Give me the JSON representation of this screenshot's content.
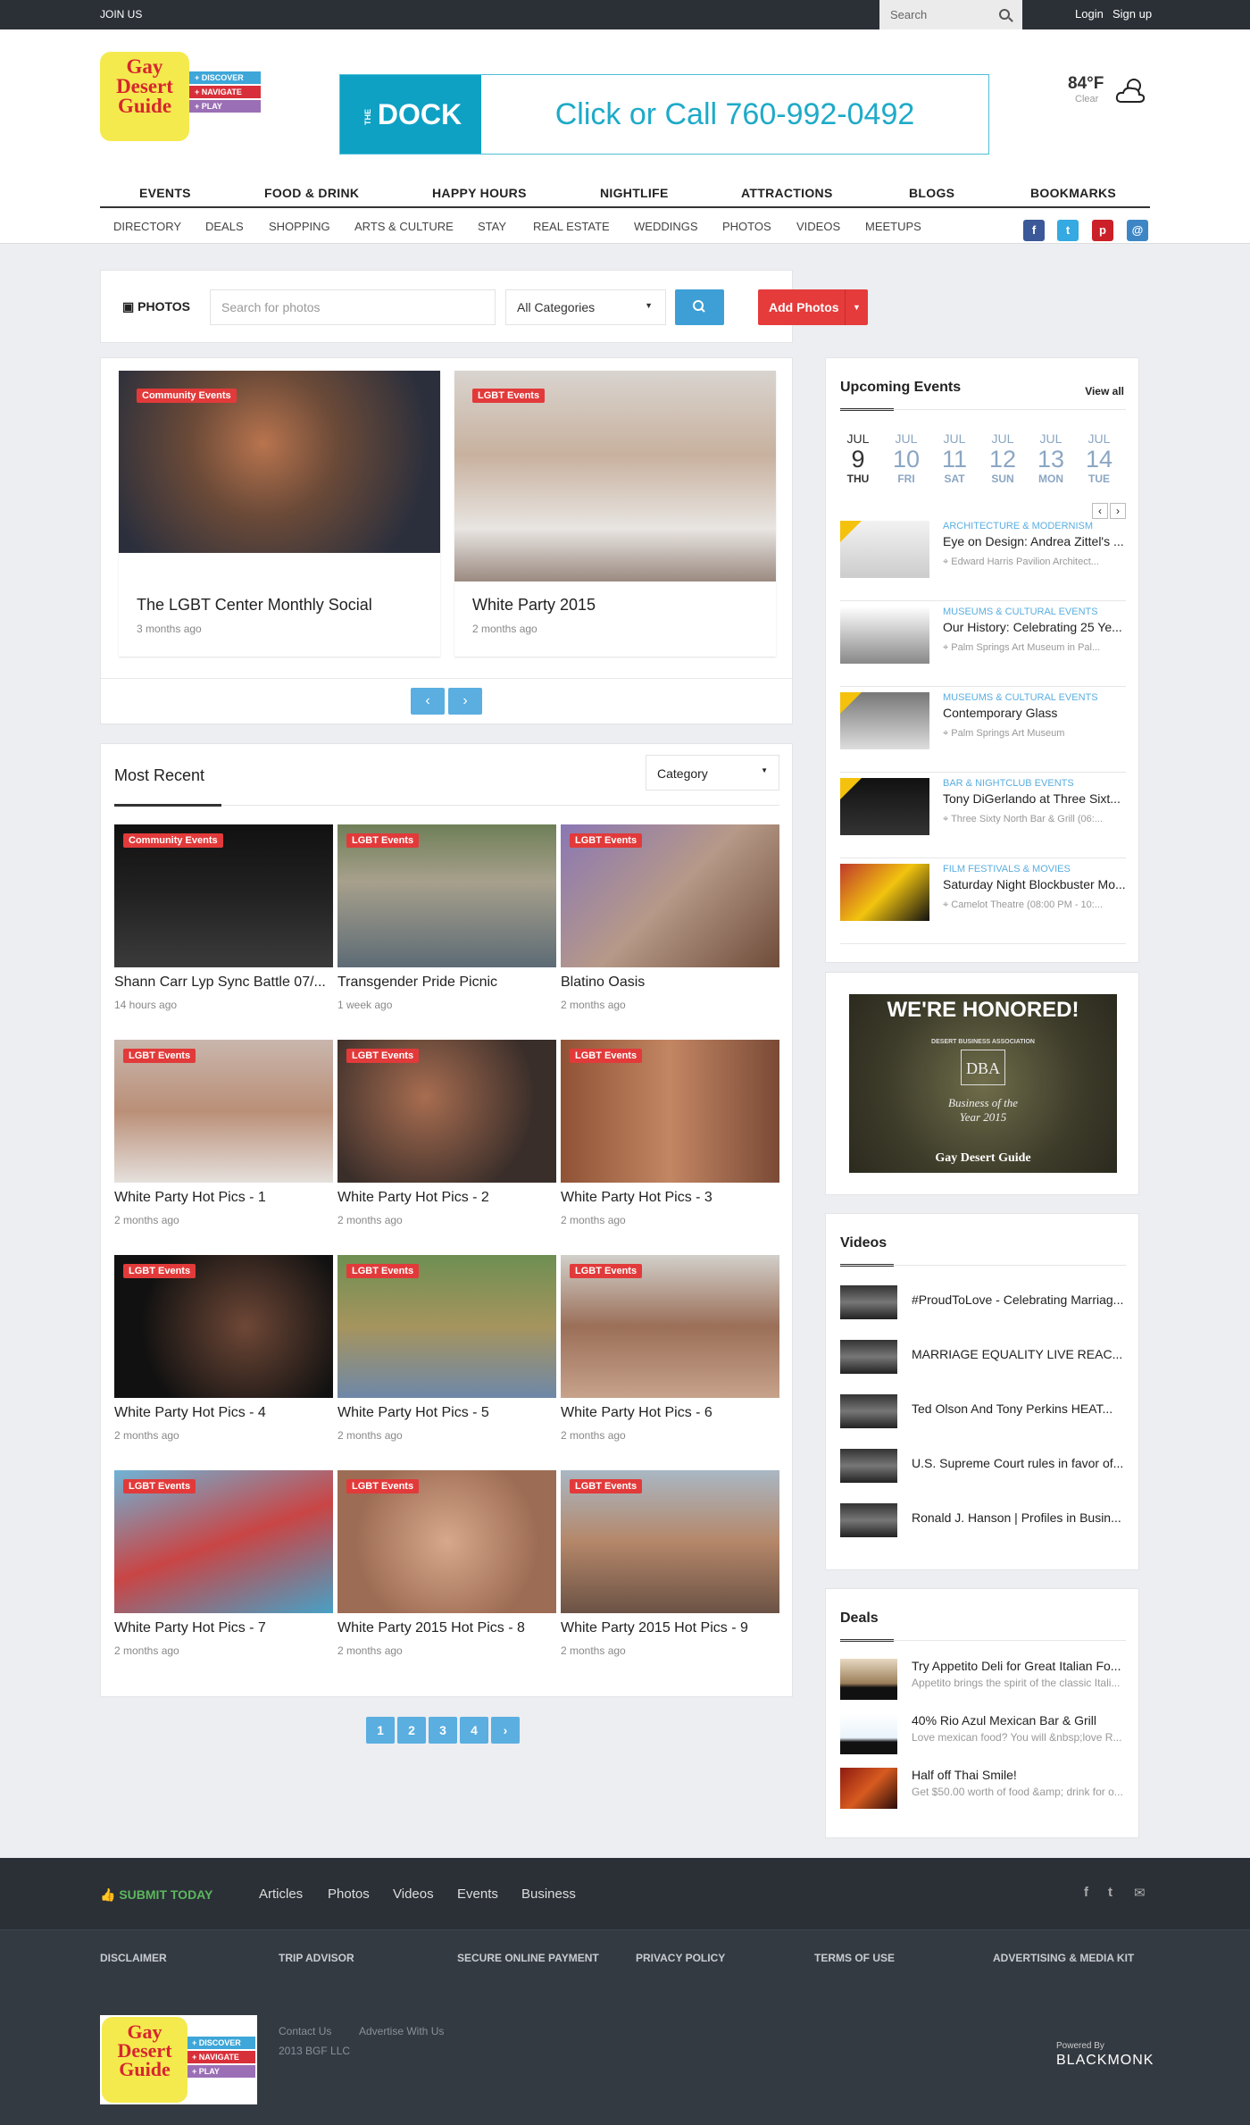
{
  "topbar": {
    "join": "JOIN US",
    "search_placeholder": "Search",
    "login": "Login",
    "signup": "Sign up"
  },
  "logo": {
    "line1": "Gay",
    "line2": "Desert",
    "line3": "Guide",
    "tag1": "+ DISCOVER",
    "tag2": "+ NAVIGATE",
    "tag3": "+ PLAY"
  },
  "ad": {
    "brand": "DOCK",
    "brand_prefix": "THE",
    "cta": "Click or Call 760-992-0492"
  },
  "weather": {
    "temp": "84°F",
    "cond": "Clear"
  },
  "nav": [
    "EVENTS",
    "FOOD & DRINK",
    "HAPPY HOURS",
    "NIGHTLIFE",
    "ATTRACTIONS",
    "BLOGS",
    "BOOKMARKS"
  ],
  "subnav": [
    "DIRECTORY",
    "DEALS",
    "SHOPPING",
    "ARTS & CULTURE",
    "STAY",
    "REAL ESTATE",
    "WEDDINGS",
    "PHOTOS",
    "VIDEOS",
    "MEETUPS"
  ],
  "photosbar": {
    "label": "PHOTOS",
    "search_placeholder": "Search for photos",
    "category": "All Categories",
    "add": "Add Photos"
  },
  "featured": [
    {
      "badge": "Community Events",
      "title": "The LGBT Center Monthly Social",
      "ago": "3 months ago"
    },
    {
      "badge": "LGBT Events",
      "title": "White Party 2015",
      "ago": "2 months ago"
    }
  ],
  "recent": {
    "title": "Most Recent",
    "category": "Category",
    "items": [
      {
        "badge": "Community Events",
        "title": "Shann Carr Lyp Sync Battle 07/...",
        "ago": "14 hours ago"
      },
      {
        "badge": "LGBT Events",
        "title": "Transgender Pride Picnic",
        "ago": "1 week ago"
      },
      {
        "badge": "LGBT Events",
        "title": "Blatino Oasis",
        "ago": "2 months ago"
      },
      {
        "badge": "LGBT Events",
        "title": "White Party Hot Pics - 1",
        "ago": "2 months ago"
      },
      {
        "badge": "LGBT Events",
        "title": "White Party Hot Pics - 2",
        "ago": "2 months ago"
      },
      {
        "badge": "LGBT Events",
        "title": "White Party Hot Pics - 3",
        "ago": "2 months ago"
      },
      {
        "badge": "LGBT Events",
        "title": "White Party Hot Pics - 4",
        "ago": "2 months ago"
      },
      {
        "badge": "LGBT Events",
        "title": "White Party Hot Pics - 5",
        "ago": "2 months ago"
      },
      {
        "badge": "LGBT Events",
        "title": "White Party Hot Pics - 6",
        "ago": "2 months ago"
      },
      {
        "badge": "LGBT Events",
        "title": "White Party Hot Pics - 7",
        "ago": "2 months ago"
      },
      {
        "badge": "LGBT Events",
        "title": "White Party 2015 Hot Pics - 8",
        "ago": "2 months ago"
      },
      {
        "badge": "LGBT Events",
        "title": "White Party 2015 Hot Pics - 9",
        "ago": "2 months ago"
      }
    ]
  },
  "pagination": [
    "1",
    "2",
    "3",
    "4",
    "›"
  ],
  "upcoming": {
    "title": "Upcoming Events",
    "viewall": "View all",
    "days": [
      {
        "m": "JUL",
        "d": "9",
        "w": "THU"
      },
      {
        "m": "JUL",
        "d": "10",
        "w": "FRI"
      },
      {
        "m": "JUL",
        "d": "11",
        "w": "SAT"
      },
      {
        "m": "JUL",
        "d": "12",
        "w": "SUN"
      },
      {
        "m": "JUL",
        "d": "13",
        "w": "MON"
      },
      {
        "m": "JUL",
        "d": "14",
        "w": "TUE"
      }
    ],
    "events": [
      {
        "cat": "ARCHITECTURE & MODERNISM",
        "name": "Eye on Design: Andrea Zittel's ...",
        "loc": "Edward Harris Pavilion Architect..."
      },
      {
        "cat": "MUSEUMS & CULTURAL EVENTS",
        "name": "Our History: Celebrating 25 Ye...",
        "loc": "Palm Springs Art Museum in Pal..."
      },
      {
        "cat": "MUSEUMS & CULTURAL EVENTS",
        "name": "Contemporary Glass",
        "loc": "Palm Springs Art Museum"
      },
      {
        "cat": "BAR & NIGHTCLUB EVENTS",
        "name": "Tony DiGerlando at Three Sixt...",
        "loc": "Three Sixty North Bar & Grill (06:..."
      },
      {
        "cat": "FILM FESTIVALS & MOVIES",
        "name": "Saturday Night Blockbuster Mo...",
        "loc": "Camelot Theatre (08:00 PM - 10:..."
      }
    ]
  },
  "honored": {
    "headline": "WE'RE HONORED!",
    "org": "DESERT BUSINESS ASSOCIATION",
    "abbr": "DBA",
    "award": "Business of the Year 2015",
    "name": "Gay Desert Guide"
  },
  "videos": {
    "title": "Videos",
    "items": [
      "#ProudToLove - Celebrating Marriag...",
      "MARRIAGE EQUALITY LIVE REAC...",
      "Ted Olson And Tony Perkins HEAT...",
      "U.S. Supreme Court rules in favor of...",
      "Ronald J. Hanson | Profiles in Busin..."
    ]
  },
  "deals": {
    "title": "Deals",
    "items": [
      {
        "name": "Try Appetito Deli for Great Italian Fo...",
        "desc": "Appetito brings the spirit of the classic Itali..."
      },
      {
        "name": "40% Rio Azul Mexican Bar & Grill",
        "desc": "Love mexican food? You will &nbsp;love R..."
      },
      {
        "name": "Half off Thai Smile!",
        "desc": "Get $50.00 worth of food &amp; drink for o..."
      }
    ]
  },
  "footer": {
    "submit": "SUBMIT TODAY",
    "links": [
      "Articles",
      "Photos",
      "Videos",
      "Events",
      "Business"
    ],
    "legal": [
      "DISCLAIMER",
      "TRIP ADVISOR",
      "SECURE ONLINE PAYMENT",
      "PRIVACY POLICY",
      "TERMS OF USE",
      "ADVERTISING & MEDIA KIT"
    ],
    "contact": "Contact Us",
    "advertise": "Advertise With Us",
    "copyright": "2013 BGF LLC",
    "powered": "Powered By",
    "company": "BLACKMONK"
  },
  "colors": {
    "accent_blue": "#3d9fd5",
    "badge_red": "#e23a3a",
    "dark": "#2b3037",
    "submit_green": "#5cb85c"
  }
}
